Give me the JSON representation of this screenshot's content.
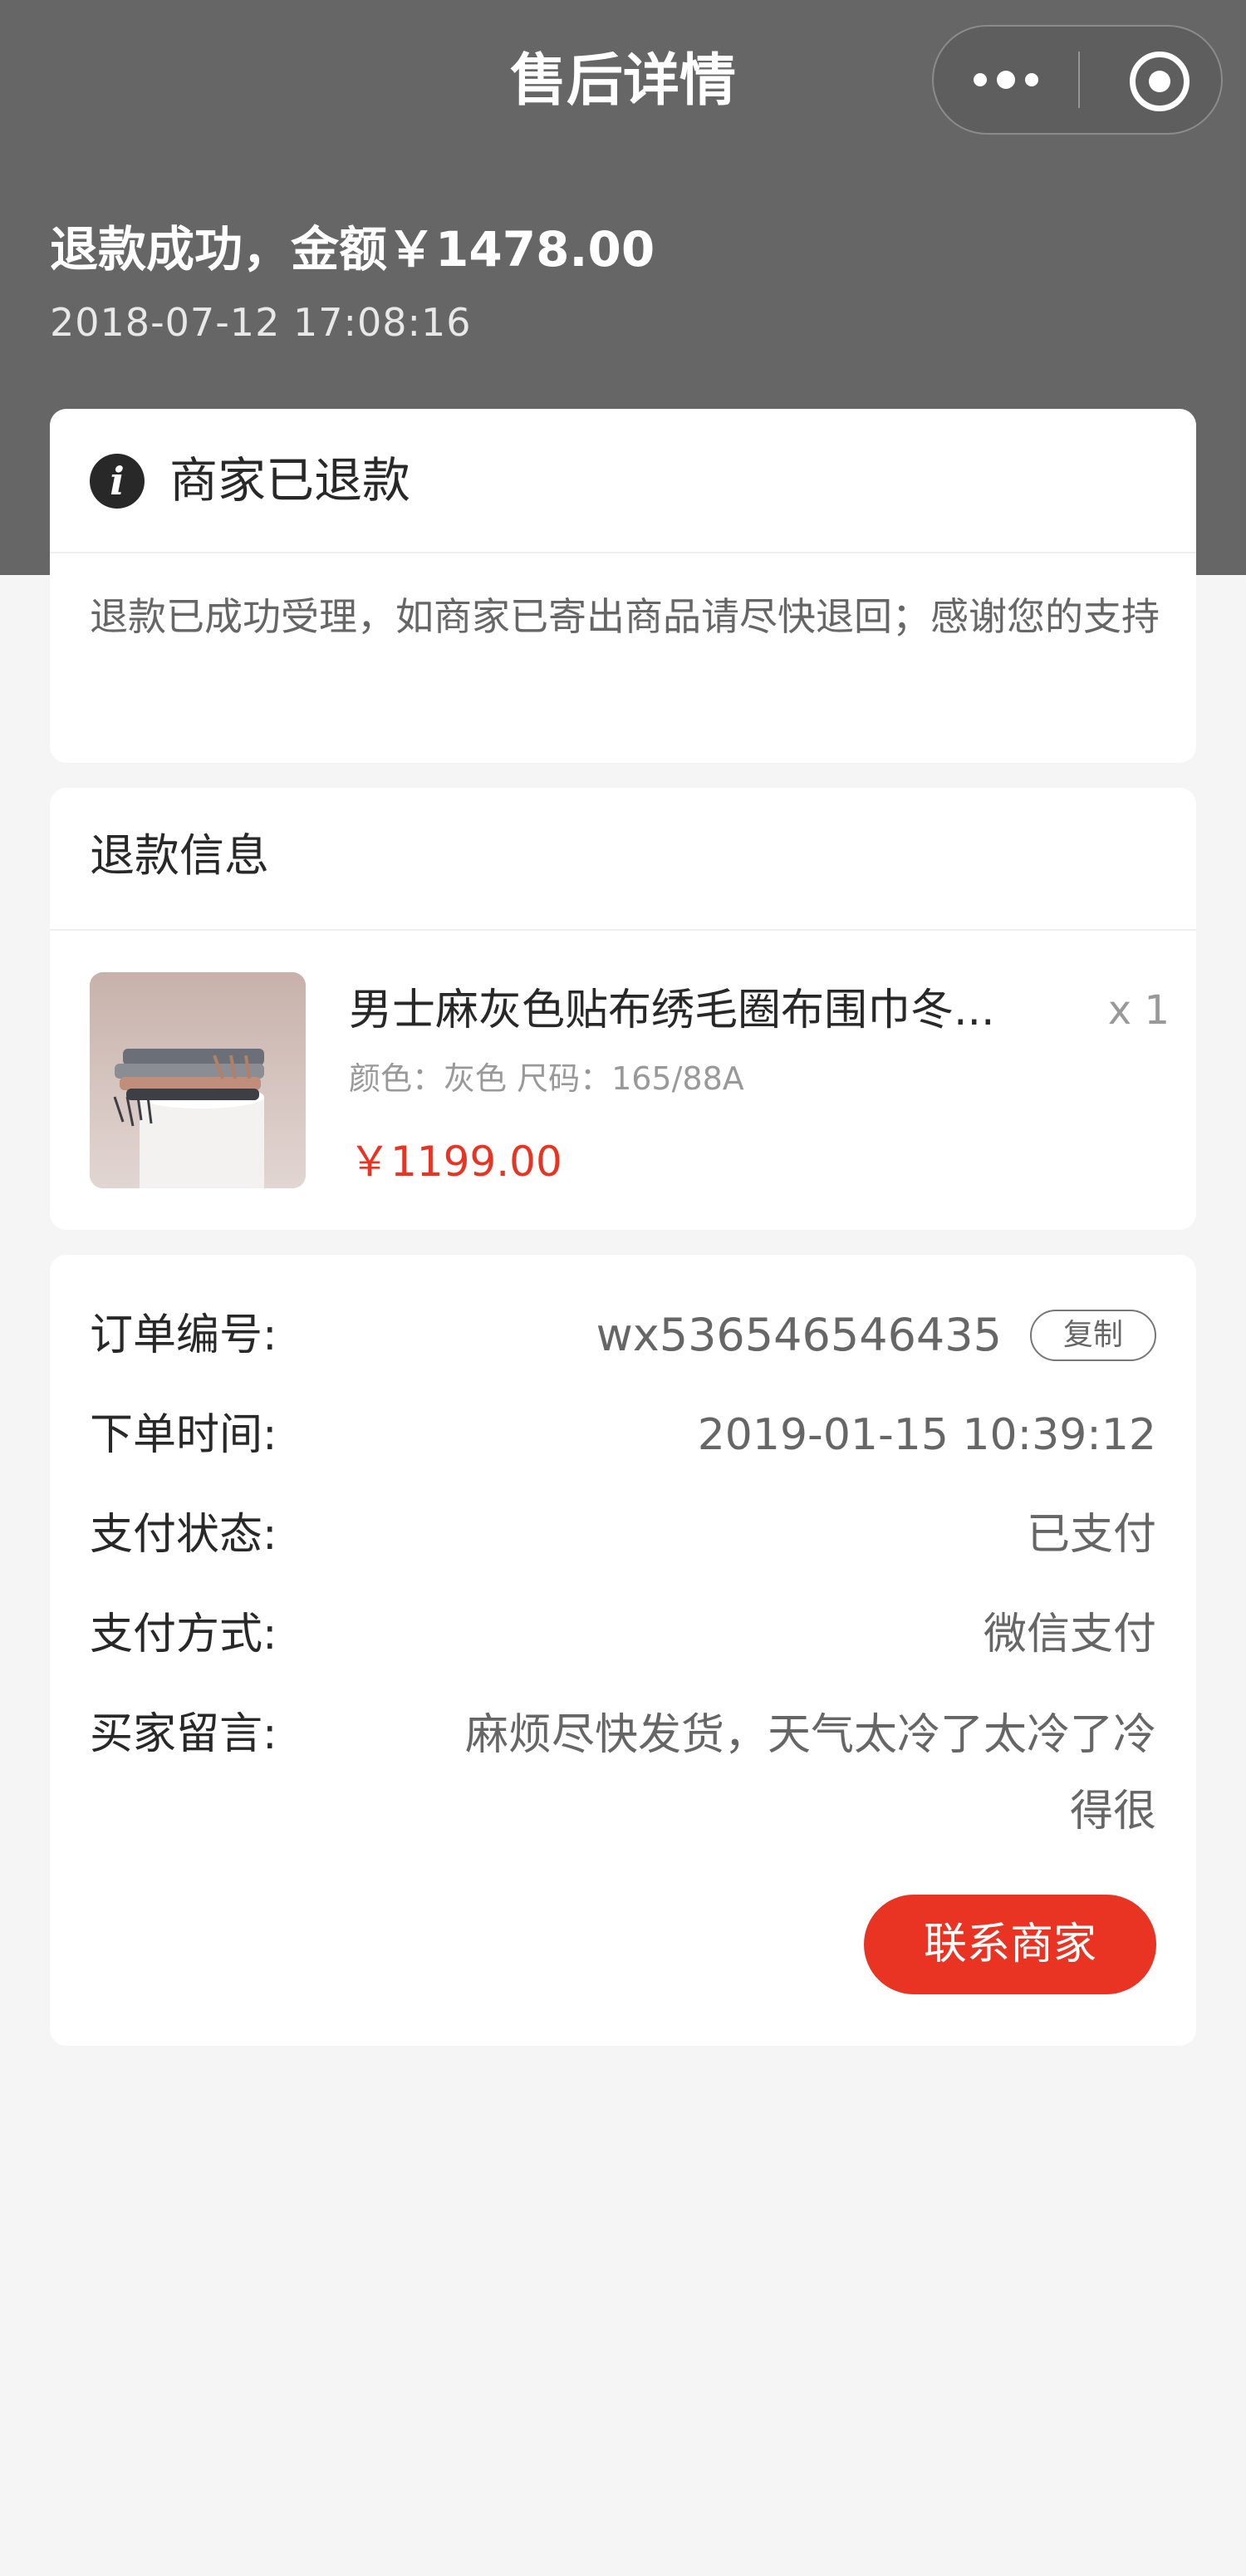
{
  "nav": {
    "title": "售后详情",
    "more_icon": "more-dots-icon",
    "close_icon": "target-icon"
  },
  "refund": {
    "title": "退款成功，金额￥1478.00",
    "time": "2018-07-12  17:08:16"
  },
  "status": {
    "icon": "info-icon",
    "text": "商家已退款",
    "description": "退款已成功受理，如商家已寄出商品请尽快退回；感谢您的支持"
  },
  "refund_info": {
    "section_title": "退款信息",
    "product": {
      "name": "男士麻灰色贴布绣毛圈布围巾冬...",
      "quantity": "x 1",
      "attributes": "颜色：灰色   尺码：165/88A",
      "price": "￥1199.00"
    }
  },
  "order": {
    "number_label": "订单编号:",
    "number_value": "wx536546546435",
    "copy_label": "复制",
    "time_label": "下单时间:",
    "time_value": "2019-01-15 10:39:12",
    "pay_status_label": "支付状态:",
    "pay_status_value": "已支付",
    "pay_method_label": "支付方式:",
    "pay_method_value": "微信支付",
    "message_label": "买家留言:",
    "message_value": "麻烦尽快发货，天气太冷了太冷了冷得很",
    "contact_button": "联系商家"
  },
  "colors": {
    "header_bg": "#666666",
    "accent": "#e93323",
    "page_bg": "#f5f5f5"
  }
}
